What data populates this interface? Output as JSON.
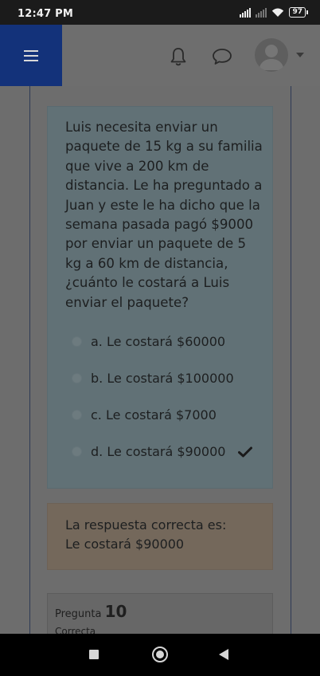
{
  "status_bar": {
    "time": "12:47 PM",
    "battery": "97",
    "icons": [
      "signal-icon",
      "signal-secondary-icon",
      "wifi-icon",
      "battery-icon"
    ]
  },
  "header": {
    "icons": [
      "menu-icon",
      "bell-icon",
      "chat-icon",
      "avatar",
      "chevron-down-icon"
    ],
    "menu_color": "#13327a"
  },
  "question": {
    "text": "Luis necesita enviar un paquete de 15 kg a su familia que vive a 200 km de distancia. Le ha preguntado a Juan y este le ha dicho que la semana pasada pagó $9000 por enviar un paquete de 5 kg a 60 km de distancia, ¿cuánto le costará a Luis enviar el paquete?",
    "options": [
      {
        "label": "a. Le costará $60000"
      },
      {
        "label": "b. Le costará $100000"
      },
      {
        "label": "c. Le costará $7000"
      },
      {
        "label": "d. Le costará $90000",
        "selected": true,
        "correct": true
      }
    ]
  },
  "feedback": {
    "line1": "La respuesta correcta es:",
    "line2": "Le costará $90000"
  },
  "next_question": {
    "label": "Pregunta",
    "number": "10",
    "status": "Correcta"
  }
}
